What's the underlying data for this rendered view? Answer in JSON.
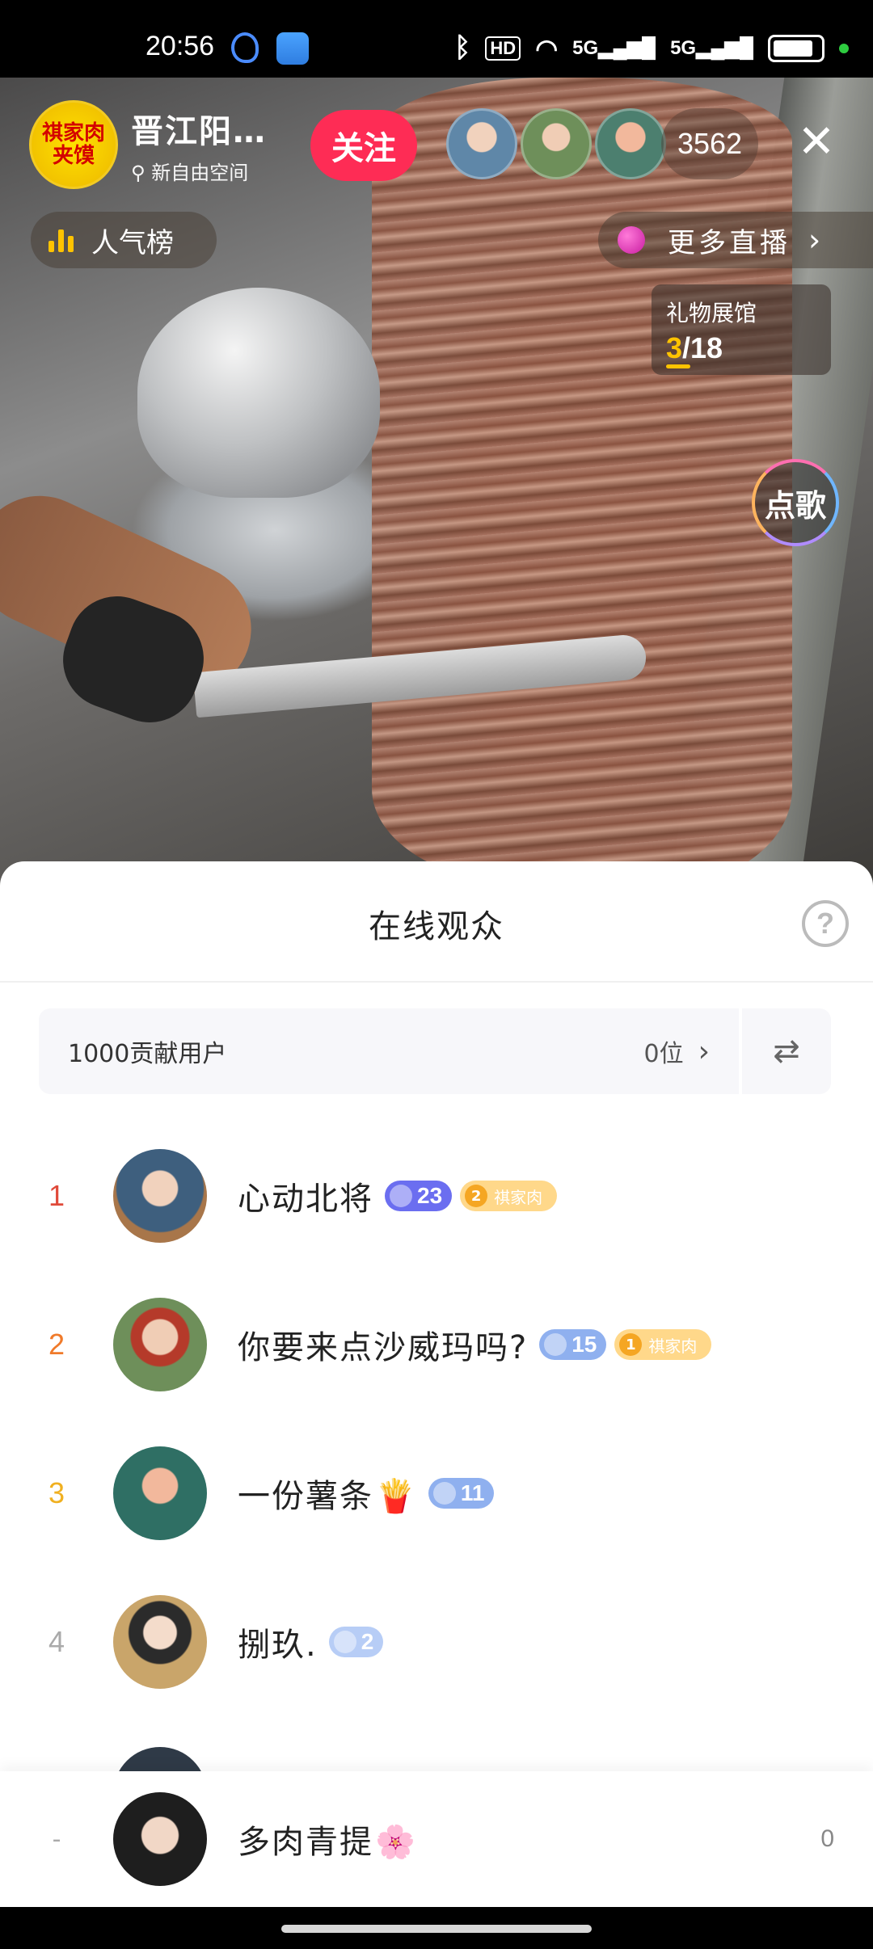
{
  "status_bar": {
    "time": "20:56",
    "network": "5G",
    "network2": "5G",
    "hd": "HD",
    "icons": [
      "bluetooth-icon",
      "hd-icon",
      "wifi-icon",
      "signal-icon",
      "signal-icon",
      "battery-icon"
    ]
  },
  "host": {
    "avatar_text": "祺家肉夹馍",
    "name": "晋江阳…",
    "location": "新自由空间",
    "follow_label": "关注"
  },
  "viewers": {
    "count": "3562"
  },
  "overlay": {
    "popularity_label": "人气榜",
    "more_live_label": "更多直播",
    "gift_hall_title": "礼物展馆",
    "gift_hall_current": "3",
    "gift_hall_total": "/18",
    "song_label": "点歌"
  },
  "sheet": {
    "title": "在线观众",
    "help": "?",
    "contrib_label": "1000贡献用户",
    "contrib_count": "0位",
    "rows": [
      {
        "rank": "1",
        "name": "心动北将",
        "level": "23",
        "fan_level": "2",
        "fan_label": "祺家肉",
        "emoji": ""
      },
      {
        "rank": "2",
        "name": "你要来点沙威玛吗?",
        "level": "15",
        "fan_level": "1",
        "fan_label": "祺家肉",
        "emoji": ""
      },
      {
        "rank": "3",
        "name": "一份薯条",
        "level": "11",
        "fan_level": "",
        "fan_label": "",
        "emoji": "🍟"
      },
      {
        "rank": "4",
        "name": "捌玖.",
        "level": "2",
        "fan_level": "",
        "fan_label": "",
        "emoji": ""
      }
    ],
    "me": {
      "rank": "-",
      "name": "多肉青提",
      "emoji": "🌸",
      "value": "0"
    }
  },
  "colors": {
    "follow": "#fe2c55",
    "rank1": "#e04a3a",
    "rank2": "#f07a2a",
    "rank3": "#f0b020",
    "rank4": "#aaaaaa",
    "level_purple": "#6b6ef0",
    "level_blue": "#8fb0ef",
    "level_light": "#b7cdf6",
    "fan_badge": "#ffd88a"
  }
}
